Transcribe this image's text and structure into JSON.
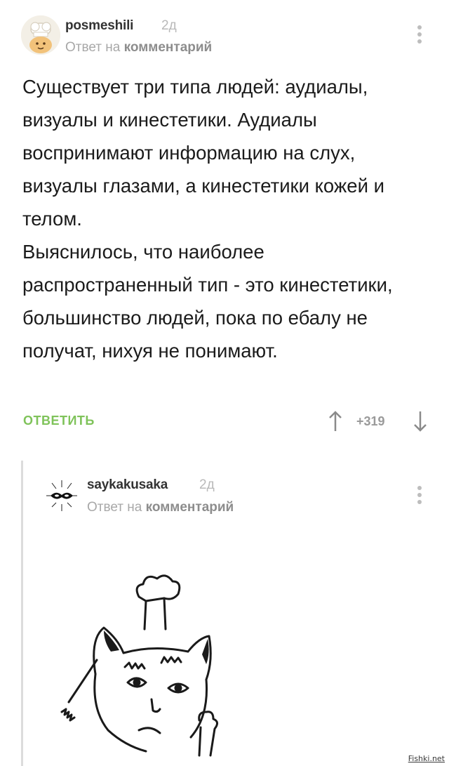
{
  "comment": {
    "author": "posmeshili",
    "age": "2д",
    "reply_prefix": "Ответ на",
    "reply_link": "комментарий",
    "paragraphs": [
      "Существует три типа людей: аудиалы, визуалы и кинестетики. Аудиалы воспринимают информацию на слух, визуалы глазами, а кинестетики кожей и телом.",
      "Выяснилось, что наиболее распространенный тип - это кинестетики, большинство людей, пока по ебалу не получат, нихуя не понимают."
    ],
    "reply_button": "ОТВЕТИТЬ",
    "rating": "+319"
  },
  "reply": {
    "author": "saykakusaka",
    "age": "2д",
    "reply_prefix": "Ответ на",
    "reply_link": "комментарий"
  },
  "watermark": "Fishki.net",
  "icons": {
    "menu": "vertical-dots-icon",
    "upvote": "arrow-up-icon",
    "downvote": "arrow-down-icon"
  },
  "colors": {
    "accent_green": "#7fc35a",
    "muted": "#a8a8a8",
    "text": "#1b1b1b"
  }
}
